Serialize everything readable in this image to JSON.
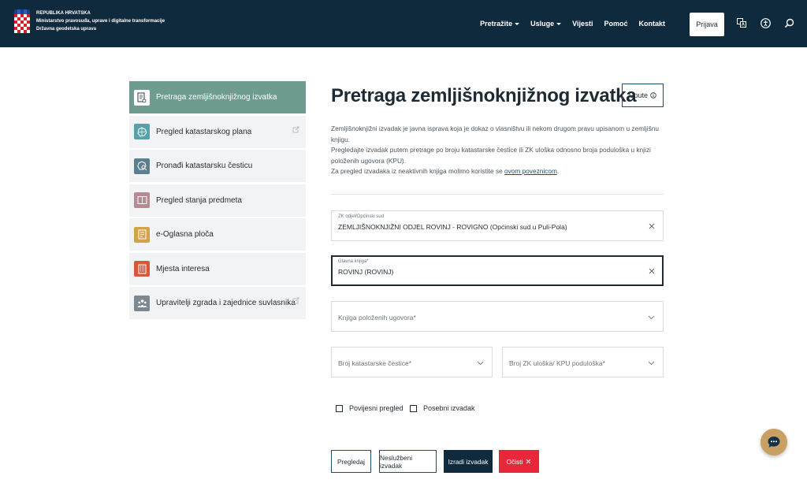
{
  "header": {
    "brand_line1": "REPUBLIKA HRVATSKA",
    "brand_line2": "Ministarstvo pravosuđa, uprave i digitalne transformacije",
    "brand_line3": "Državna geodetska uprava",
    "nav": [
      {
        "label": "Pretražite",
        "dropdown": true
      },
      {
        "label": "Usluge",
        "dropdown": true
      },
      {
        "label": "Vijesti",
        "dropdown": false
      },
      {
        "label": "Pomoć",
        "dropdown": false
      },
      {
        "label": "Kontakt",
        "dropdown": false
      }
    ],
    "login_label": "Prijava",
    "icons": [
      "language-icon",
      "accessibility-icon",
      "search-icon"
    ],
    "color_bg": "#0f2a3d"
  },
  "sidebar": {
    "items": [
      {
        "label": "Pretraga zemljišnoknjižnog izvatka",
        "icon": "document-icon",
        "color": "#ffffff",
        "active": true,
        "external": false
      },
      {
        "label": "Pregled katastarskog plana",
        "icon": "map-icon",
        "color": "#5aa0a8",
        "active": false,
        "external": true
      },
      {
        "label": "Pronađi katastarsku česticu",
        "icon": "parcel-search-icon",
        "color": "#5c7f8f",
        "active": false,
        "external": false
      },
      {
        "label": "Pregled stanja predmeta",
        "icon": "book-icon",
        "color": "#b58a92",
        "active": false,
        "external": false
      },
      {
        "label": "e-Oglasna ploča",
        "icon": "notice-icon",
        "color": "#d2a34d",
        "active": false,
        "external": false
      },
      {
        "label": "Mjesta interesa",
        "icon": "building-icon",
        "color": "#d5583d",
        "active": false,
        "external": false
      },
      {
        "label": "Upravitelji zgrada i zajednice suvlasnika",
        "icon": "people-icon",
        "color": "#7e8891",
        "active": false,
        "external": true
      }
    ]
  },
  "main": {
    "title": "Pretraga zemljišnoknjižnog izvatka",
    "upute_label": "Upute",
    "intro_p1": "Zemljišnoknjižni izvadak je javna isprava koja je dokaz o vlasništvu ili nekom drugom pravu upisanom u zemljišnu knjigu.",
    "intro_p2": "Pregledajte izvadak putem pretrage po broju katastarske čestice ili ZK uloška odnosno broja poduloška u knjizi položenih ugovora (KPU).",
    "intro_p3_prefix": "Za pregled izvadaka iz neaktivnih knjiga molimo koristite se ",
    "intro_p3_link": "ovom poveznicom",
    "intro_p3_suffix": ".",
    "fields": {
      "zk_odjel": {
        "label": "ZK odjel/Općinski sud",
        "value": "ZEMLJIŠNOKNJIŽNI ODJEL ROVINJ - ROVIGNO (Općinski sud u Puli-Pola)"
      },
      "glavna_knjiga": {
        "label": "Glavna knjiga*",
        "value": "ROVINJ (ROVINJ)"
      },
      "kpu": {
        "placeholder": "Knjiga položenih ugovora*"
      },
      "cestica": {
        "placeholder": "Broj katastarske čestice*"
      },
      "zk_ulozak": {
        "placeholder": "Broj ZK uloška/ KPU poduloška*"
      }
    },
    "checkboxes": [
      {
        "label": "Povijesni pregled",
        "checked": false
      },
      {
        "label": "Posebni izvadak",
        "checked": false
      }
    ],
    "buttons": {
      "pregledaj": "Pregledaj",
      "nesluzbeni": "Neslužbeni izvadak",
      "izradi": "Izradi izvadak",
      "ocisti": "Očisti"
    }
  }
}
